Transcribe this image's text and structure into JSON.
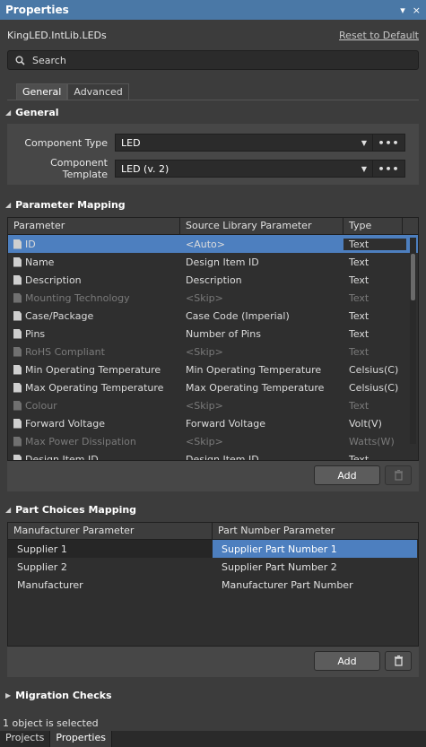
{
  "panel": {
    "title": "Properties",
    "pin_glyph": "▾",
    "close_glyph": "×"
  },
  "header": {
    "file_name": "KingLED.IntLib.LEDs",
    "reset_label": "Reset to Default"
  },
  "search": {
    "placeholder": "Search"
  },
  "tabs": [
    {
      "label": "General"
    },
    {
      "label": "Advanced"
    }
  ],
  "general": {
    "title": "General",
    "component_type": {
      "label": "Component Type",
      "value": "LED"
    },
    "component_template": {
      "label": "Component Template",
      "value": "LED (v. 2)"
    }
  },
  "parameter_mapping": {
    "title": "Parameter Mapping",
    "columns": [
      "Parameter",
      "Source Library Parameter",
      "Type"
    ],
    "rows": [
      {
        "parameter": "ID",
        "source": "<Auto>",
        "type": "Text",
        "dim": false,
        "selected": true
      },
      {
        "parameter": "Name",
        "source": "Design Item ID",
        "type": "Text",
        "dim": false
      },
      {
        "parameter": "Description",
        "source": "Description",
        "type": "Text",
        "dim": false
      },
      {
        "parameter": "Mounting Technology",
        "source": "<Skip>",
        "type": "Text",
        "dim": true
      },
      {
        "parameter": "Case/Package",
        "source": "Case Code (Imperial)",
        "type": "Text",
        "dim": false
      },
      {
        "parameter": "Pins",
        "source": "Number of Pins",
        "type": "Text",
        "dim": false
      },
      {
        "parameter": "RoHS Compliant",
        "source": "<Skip>",
        "type": "Text",
        "dim": true
      },
      {
        "parameter": "Min Operating Temperature",
        "source": "Min Operating Temperature",
        "type": "Celsius(C)",
        "dim": false
      },
      {
        "parameter": "Max Operating Temperature",
        "source": "Max Operating Temperature",
        "type": "Celsius(C)",
        "dim": false
      },
      {
        "parameter": "Colour",
        "source": "<Skip>",
        "type": "Text",
        "dim": true
      },
      {
        "parameter": "Forward Voltage",
        "source": "Forward Voltage",
        "type": "Volt(V)",
        "dim": false
      },
      {
        "parameter": "Max Power Dissipation",
        "source": "<Skip>",
        "type": "Watts(W)",
        "dim": true
      },
      {
        "parameter": "Design Item ID",
        "source": "Design Item ID",
        "type": "Text",
        "dim": false
      }
    ],
    "add_label": "Add"
  },
  "part_choices": {
    "title": "Part Choices Mapping",
    "columns": [
      "Manufacturer Parameter",
      "Part Number Parameter"
    ],
    "rows": [
      {
        "manufacturer": "Supplier 1",
        "part_number": "Supplier Part Number 1"
      },
      {
        "manufacturer": "Supplier 2",
        "part_number": "Supplier Part Number 2"
      },
      {
        "manufacturer": "Manufacturer",
        "part_number": "Manufacturer Part Number"
      }
    ],
    "add_label": "Add"
  },
  "migration": {
    "title": "Migration Checks"
  },
  "status": {
    "text": "1 object is selected"
  },
  "bottom_tabs": [
    {
      "label": "Projects"
    },
    {
      "label": "Properties"
    }
  ]
}
